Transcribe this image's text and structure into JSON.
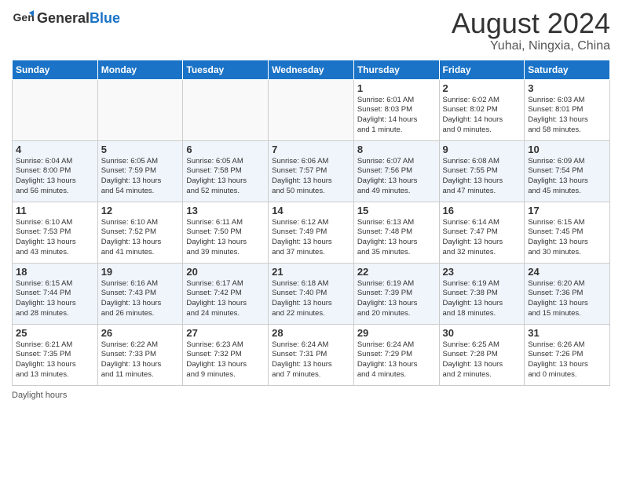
{
  "header": {
    "logo_general": "General",
    "logo_blue": "Blue",
    "month_year": "August 2024",
    "location": "Yuhai, Ningxia, China"
  },
  "days_of_week": [
    "Sunday",
    "Monday",
    "Tuesday",
    "Wednesday",
    "Thursday",
    "Friday",
    "Saturday"
  ],
  "weeks": [
    [
      {
        "day": "",
        "info": ""
      },
      {
        "day": "",
        "info": ""
      },
      {
        "day": "",
        "info": ""
      },
      {
        "day": "",
        "info": ""
      },
      {
        "day": "1",
        "info": "Sunrise: 6:01 AM\nSunset: 8:03 PM\nDaylight: 14 hours\nand 1 minute."
      },
      {
        "day": "2",
        "info": "Sunrise: 6:02 AM\nSunset: 8:02 PM\nDaylight: 14 hours\nand 0 minutes."
      },
      {
        "day": "3",
        "info": "Sunrise: 6:03 AM\nSunset: 8:01 PM\nDaylight: 13 hours\nand 58 minutes."
      }
    ],
    [
      {
        "day": "4",
        "info": "Sunrise: 6:04 AM\nSunset: 8:00 PM\nDaylight: 13 hours\nand 56 minutes."
      },
      {
        "day": "5",
        "info": "Sunrise: 6:05 AM\nSunset: 7:59 PM\nDaylight: 13 hours\nand 54 minutes."
      },
      {
        "day": "6",
        "info": "Sunrise: 6:05 AM\nSunset: 7:58 PM\nDaylight: 13 hours\nand 52 minutes."
      },
      {
        "day": "7",
        "info": "Sunrise: 6:06 AM\nSunset: 7:57 PM\nDaylight: 13 hours\nand 50 minutes."
      },
      {
        "day": "8",
        "info": "Sunrise: 6:07 AM\nSunset: 7:56 PM\nDaylight: 13 hours\nand 49 minutes."
      },
      {
        "day": "9",
        "info": "Sunrise: 6:08 AM\nSunset: 7:55 PM\nDaylight: 13 hours\nand 47 minutes."
      },
      {
        "day": "10",
        "info": "Sunrise: 6:09 AM\nSunset: 7:54 PM\nDaylight: 13 hours\nand 45 minutes."
      }
    ],
    [
      {
        "day": "11",
        "info": "Sunrise: 6:10 AM\nSunset: 7:53 PM\nDaylight: 13 hours\nand 43 minutes."
      },
      {
        "day": "12",
        "info": "Sunrise: 6:10 AM\nSunset: 7:52 PM\nDaylight: 13 hours\nand 41 minutes."
      },
      {
        "day": "13",
        "info": "Sunrise: 6:11 AM\nSunset: 7:50 PM\nDaylight: 13 hours\nand 39 minutes."
      },
      {
        "day": "14",
        "info": "Sunrise: 6:12 AM\nSunset: 7:49 PM\nDaylight: 13 hours\nand 37 minutes."
      },
      {
        "day": "15",
        "info": "Sunrise: 6:13 AM\nSunset: 7:48 PM\nDaylight: 13 hours\nand 35 minutes."
      },
      {
        "day": "16",
        "info": "Sunrise: 6:14 AM\nSunset: 7:47 PM\nDaylight: 13 hours\nand 32 minutes."
      },
      {
        "day": "17",
        "info": "Sunrise: 6:15 AM\nSunset: 7:45 PM\nDaylight: 13 hours\nand 30 minutes."
      }
    ],
    [
      {
        "day": "18",
        "info": "Sunrise: 6:15 AM\nSunset: 7:44 PM\nDaylight: 13 hours\nand 28 minutes."
      },
      {
        "day": "19",
        "info": "Sunrise: 6:16 AM\nSunset: 7:43 PM\nDaylight: 13 hours\nand 26 minutes."
      },
      {
        "day": "20",
        "info": "Sunrise: 6:17 AM\nSunset: 7:42 PM\nDaylight: 13 hours\nand 24 minutes."
      },
      {
        "day": "21",
        "info": "Sunrise: 6:18 AM\nSunset: 7:40 PM\nDaylight: 13 hours\nand 22 minutes."
      },
      {
        "day": "22",
        "info": "Sunrise: 6:19 AM\nSunset: 7:39 PM\nDaylight: 13 hours\nand 20 minutes."
      },
      {
        "day": "23",
        "info": "Sunrise: 6:19 AM\nSunset: 7:38 PM\nDaylight: 13 hours\nand 18 minutes."
      },
      {
        "day": "24",
        "info": "Sunrise: 6:20 AM\nSunset: 7:36 PM\nDaylight: 13 hours\nand 15 minutes."
      }
    ],
    [
      {
        "day": "25",
        "info": "Sunrise: 6:21 AM\nSunset: 7:35 PM\nDaylight: 13 hours\nand 13 minutes."
      },
      {
        "day": "26",
        "info": "Sunrise: 6:22 AM\nSunset: 7:33 PM\nDaylight: 13 hours\nand 11 minutes."
      },
      {
        "day": "27",
        "info": "Sunrise: 6:23 AM\nSunset: 7:32 PM\nDaylight: 13 hours\nand 9 minutes."
      },
      {
        "day": "28",
        "info": "Sunrise: 6:24 AM\nSunset: 7:31 PM\nDaylight: 13 hours\nand 7 minutes."
      },
      {
        "day": "29",
        "info": "Sunrise: 6:24 AM\nSunset: 7:29 PM\nDaylight: 13 hours\nand 4 minutes."
      },
      {
        "day": "30",
        "info": "Sunrise: 6:25 AM\nSunset: 7:28 PM\nDaylight: 13 hours\nand 2 minutes."
      },
      {
        "day": "31",
        "info": "Sunrise: 6:26 AM\nSunset: 7:26 PM\nDaylight: 13 hours\nand 0 minutes."
      }
    ]
  ],
  "footer": {
    "daylight_label": "Daylight hours"
  }
}
